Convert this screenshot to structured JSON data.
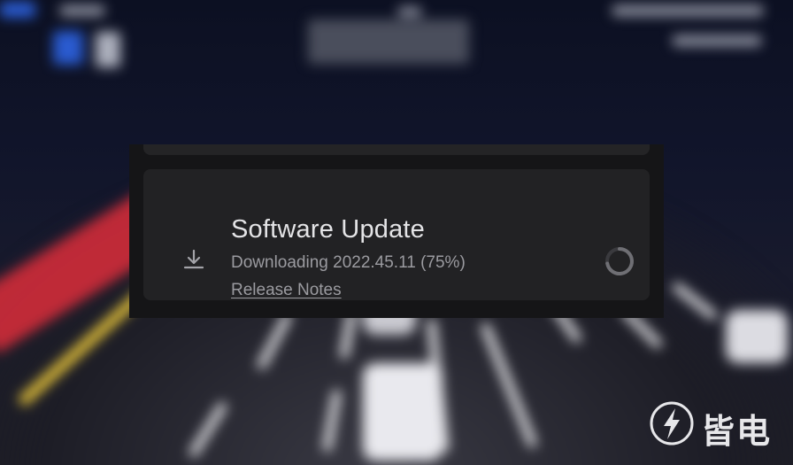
{
  "notification": {
    "title": "Software Update",
    "status": "Downloading 2022.45.11 (75%)",
    "release_notes_label": "Release Notes",
    "progress_percent": 75,
    "icon": "download-icon",
    "spinner_icon": "loading-spinner-icon"
  },
  "watermark": {
    "text": "皆电",
    "logo_icon": "lightning-bolt-logo"
  },
  "colors": {
    "panel_bg": "#151517",
    "card_bg": "#222224",
    "title_text": "#e4e4e6",
    "secondary_text": "#9b9ba0"
  }
}
